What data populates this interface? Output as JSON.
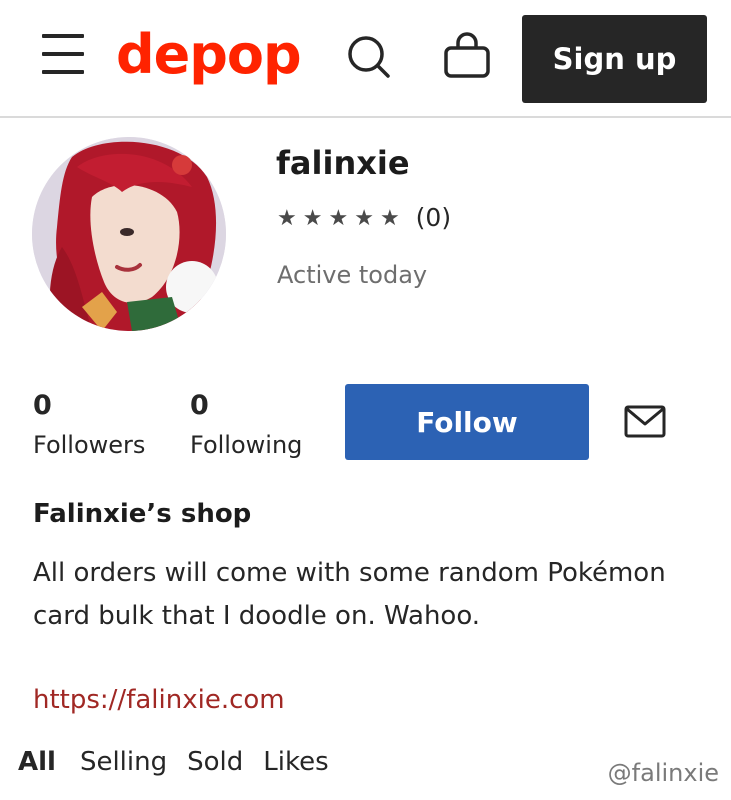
{
  "header": {
    "logo": "depop",
    "signup_label": "Sign up"
  },
  "profile": {
    "username": "falinxie",
    "rating_stars": 0,
    "review_count": "(0)",
    "activity": "Active today",
    "followers": {
      "count": "0",
      "label": "Followers"
    },
    "following": {
      "count": "0",
      "label": "Following"
    },
    "follow_label": "Follow"
  },
  "shop": {
    "title": "Falinxie’s shop",
    "bio": "All orders will come with some random Pokémon card bulk that I doodle on. Wahoo.",
    "link": "https://falinxie.com"
  },
  "tabs": [
    {
      "label": "All",
      "active": true
    },
    {
      "label": "Selling",
      "active": false
    },
    {
      "label": "Sold",
      "active": false
    },
    {
      "label": "Likes",
      "active": false
    }
  ],
  "watermark": "@falinxie",
  "colors": {
    "brand": "#ff2300",
    "follow_button": "#2c62b4",
    "signup_button": "#262626",
    "link": "#a02824"
  },
  "icons": [
    "menu-icon",
    "search-icon",
    "bag-icon",
    "mail-icon",
    "star-icon"
  ]
}
